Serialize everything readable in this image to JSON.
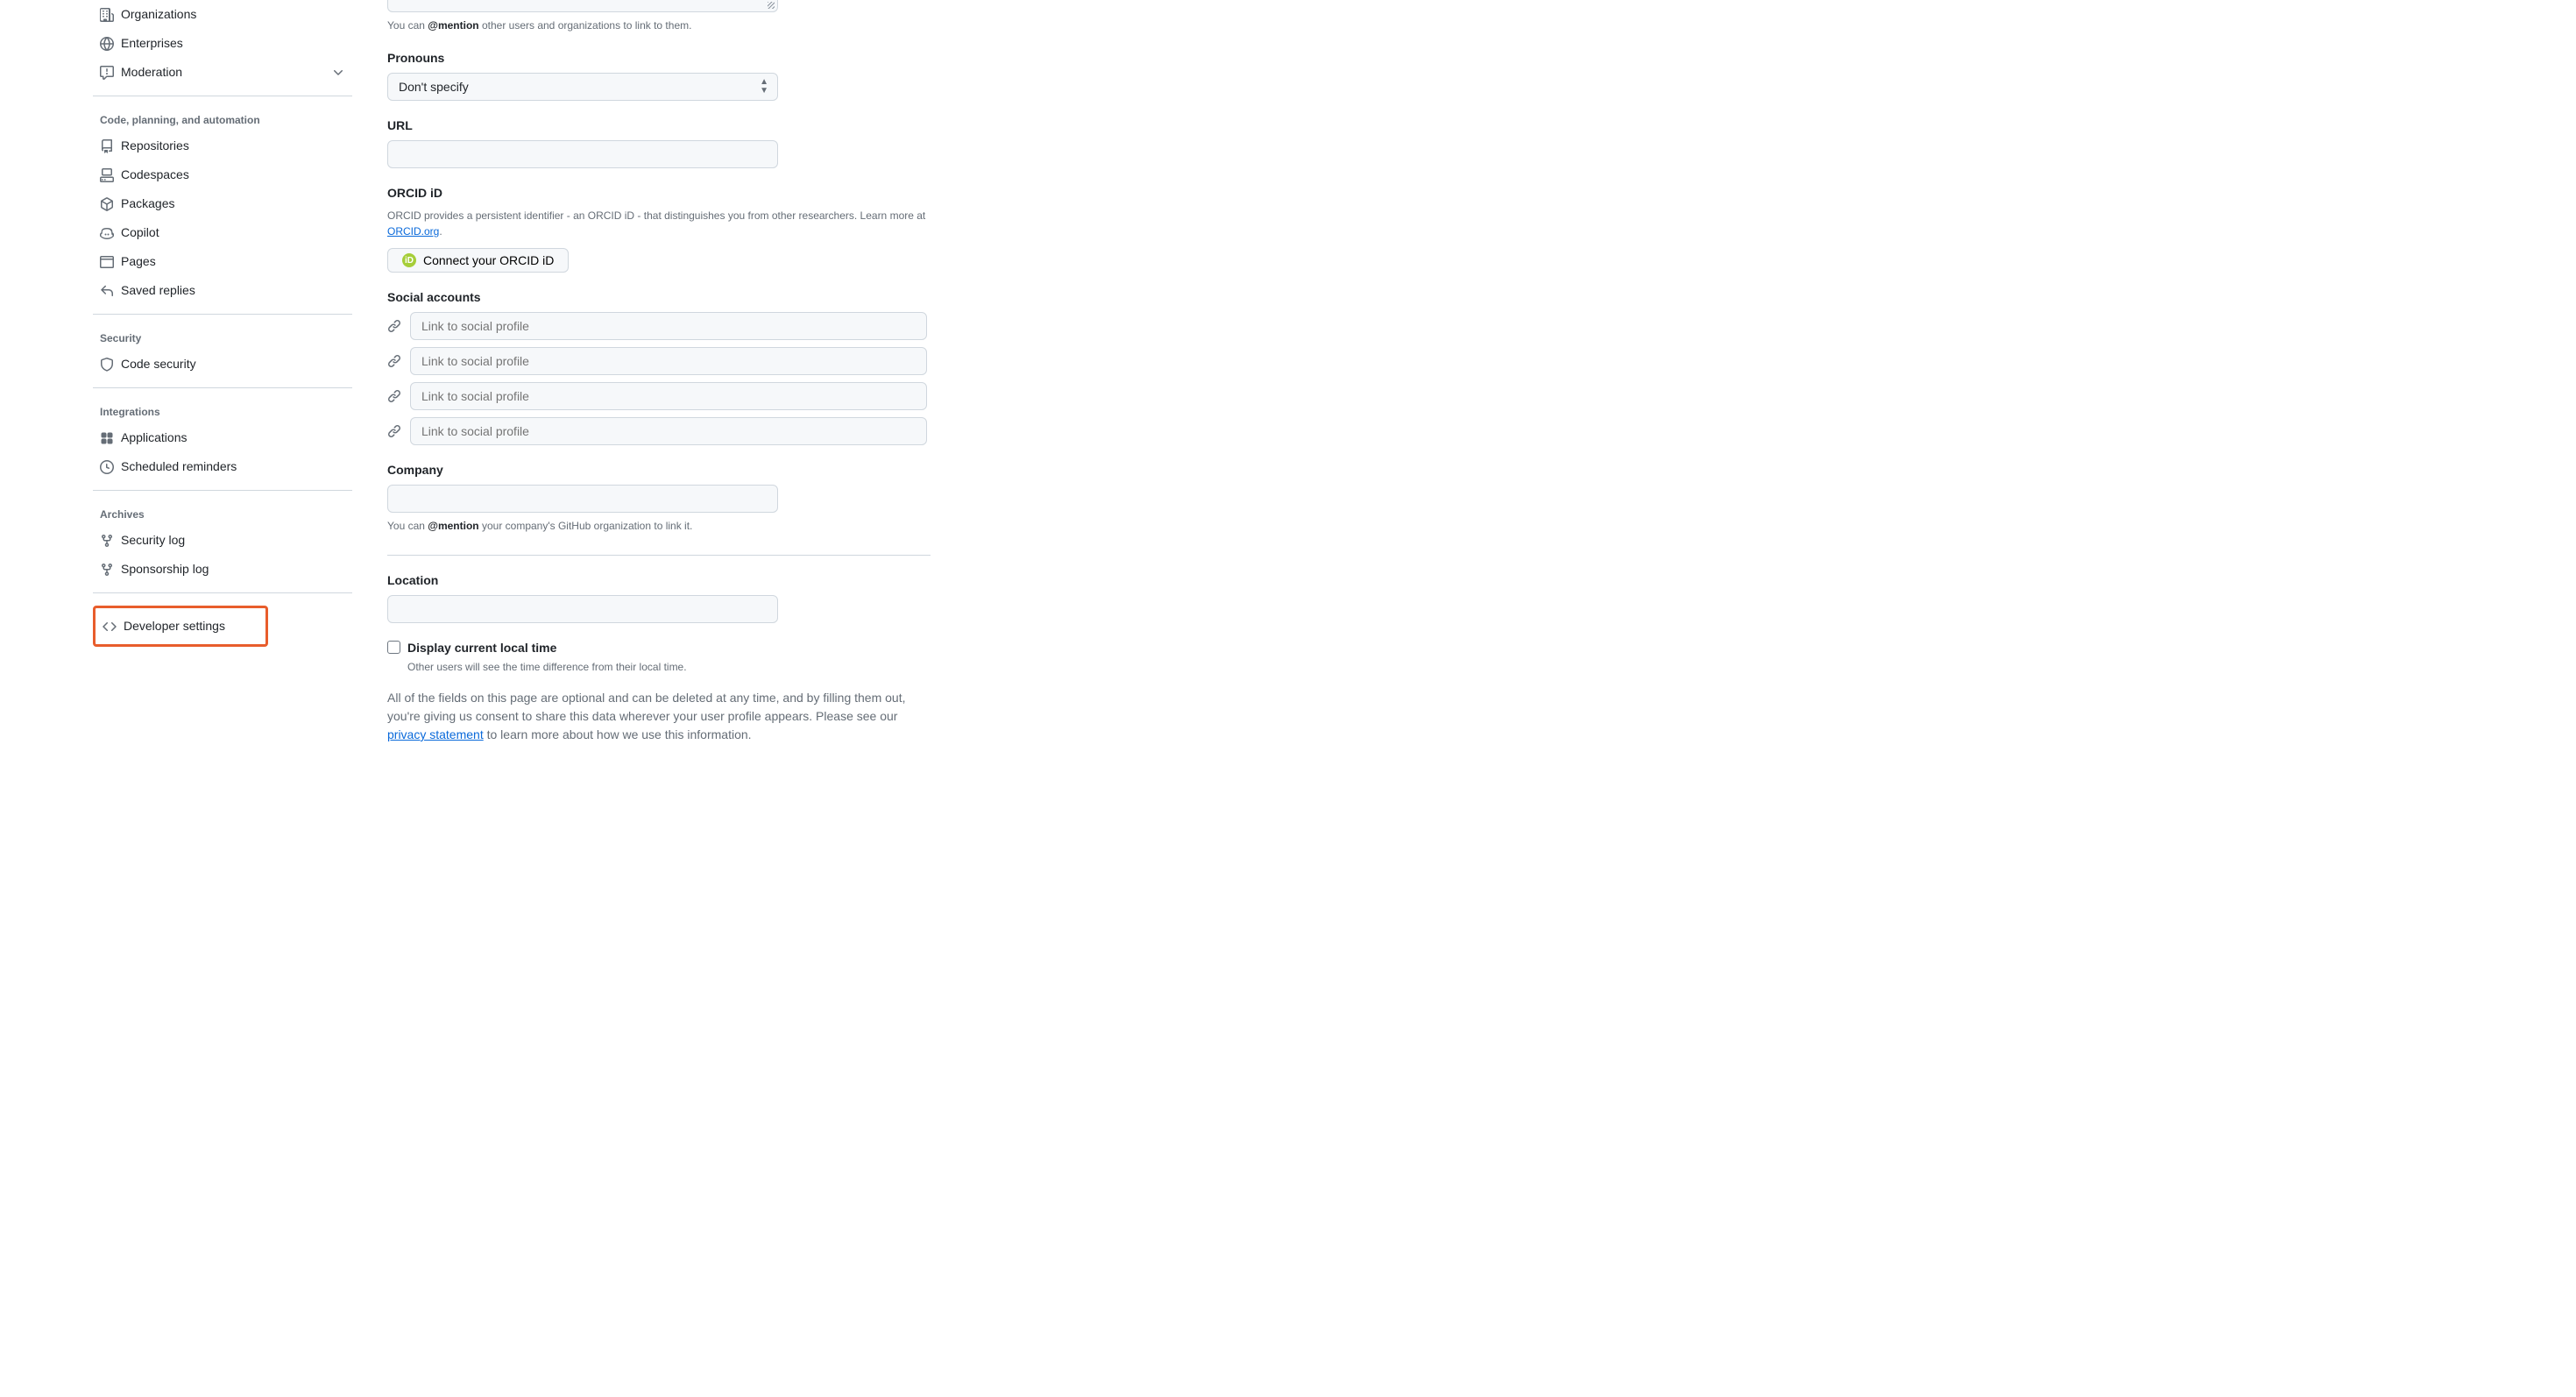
{
  "sidebar": {
    "section1": [
      {
        "label": "Organizations"
      },
      {
        "label": "Enterprises"
      },
      {
        "label": "Moderation"
      }
    ],
    "heading_code": "Code, planning, and automation",
    "section2": [
      {
        "label": "Repositories"
      },
      {
        "label": "Codespaces"
      },
      {
        "label": "Packages"
      },
      {
        "label": "Copilot"
      },
      {
        "label": "Pages"
      },
      {
        "label": "Saved replies"
      }
    ],
    "heading_security": "Security",
    "section3": [
      {
        "label": "Code security"
      }
    ],
    "heading_integrations": "Integrations",
    "section4": [
      {
        "label": "Applications"
      },
      {
        "label": "Scheduled reminders"
      }
    ],
    "heading_archives": "Archives",
    "section5": [
      {
        "label": "Security log"
      },
      {
        "label": "Sponsorship log"
      }
    ],
    "developer_settings": "Developer settings"
  },
  "main": {
    "bio_helper_prefix": "You can ",
    "bio_helper_mention": "@mention",
    "bio_helper_suffix": " other users and organizations to link to them.",
    "pronouns_label": "Pronouns",
    "pronouns_value": "Don't specify",
    "url_label": "URL",
    "orcid_label": "ORCID iD",
    "orcid_desc_prefix": "ORCID provides a persistent identifier - an ORCID iD - that distinguishes you from other researchers. Learn more at ",
    "orcid_link": "ORCID.org",
    "orcid_desc_suffix": ".",
    "orcid_btn": "Connect your ORCID iD",
    "orcid_badge": "iD",
    "social_label": "Social accounts",
    "social_placeholder": "Link to social profile",
    "company_label": "Company",
    "company_helper_prefix": "You can ",
    "company_helper_mention": "@mention",
    "company_helper_suffix": " your company's GitHub organization to link it.",
    "location_label": "Location",
    "localtime_label": "Display current local time",
    "localtime_helper": "Other users will see the time difference from their local time.",
    "footer_prefix": "All of the fields on this page are optional and can be deleted at any time, and by filling them out, you're giving us consent to share this data wherever your user profile appears. Please see our ",
    "footer_link": "privacy statement",
    "footer_suffix": " to learn more about how we use this information."
  }
}
